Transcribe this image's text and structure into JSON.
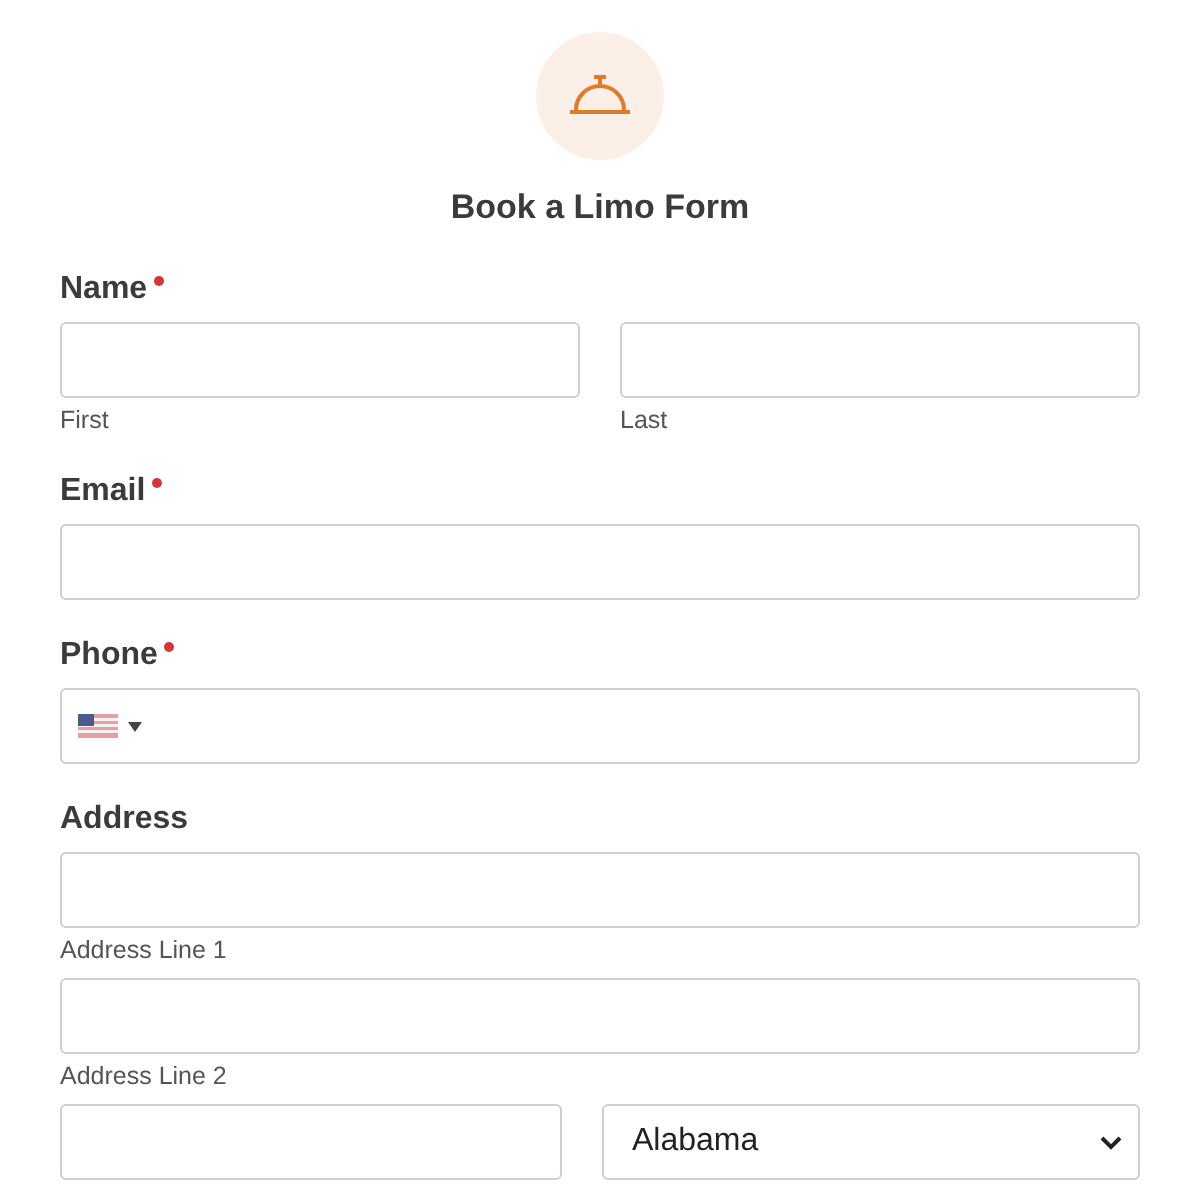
{
  "header": {
    "title": "Book a Limo Form"
  },
  "fields": [
    {
      "kind": "name",
      "label": "Name",
      "required": true,
      "parts": [
        {
          "sublabel": "First"
        },
        {
          "sublabel": "Last"
        }
      ]
    },
    {
      "kind": "text",
      "label": "Email",
      "required": true
    },
    {
      "kind": "phone",
      "label": "Phone",
      "required": true
    },
    {
      "kind": "address",
      "label": "Address",
      "required": false,
      "lines": [
        {
          "sublabel": "Address Line 1"
        },
        {
          "sublabel": "Address Line 2"
        }
      ],
      "state": "Alabama"
    }
  ]
}
